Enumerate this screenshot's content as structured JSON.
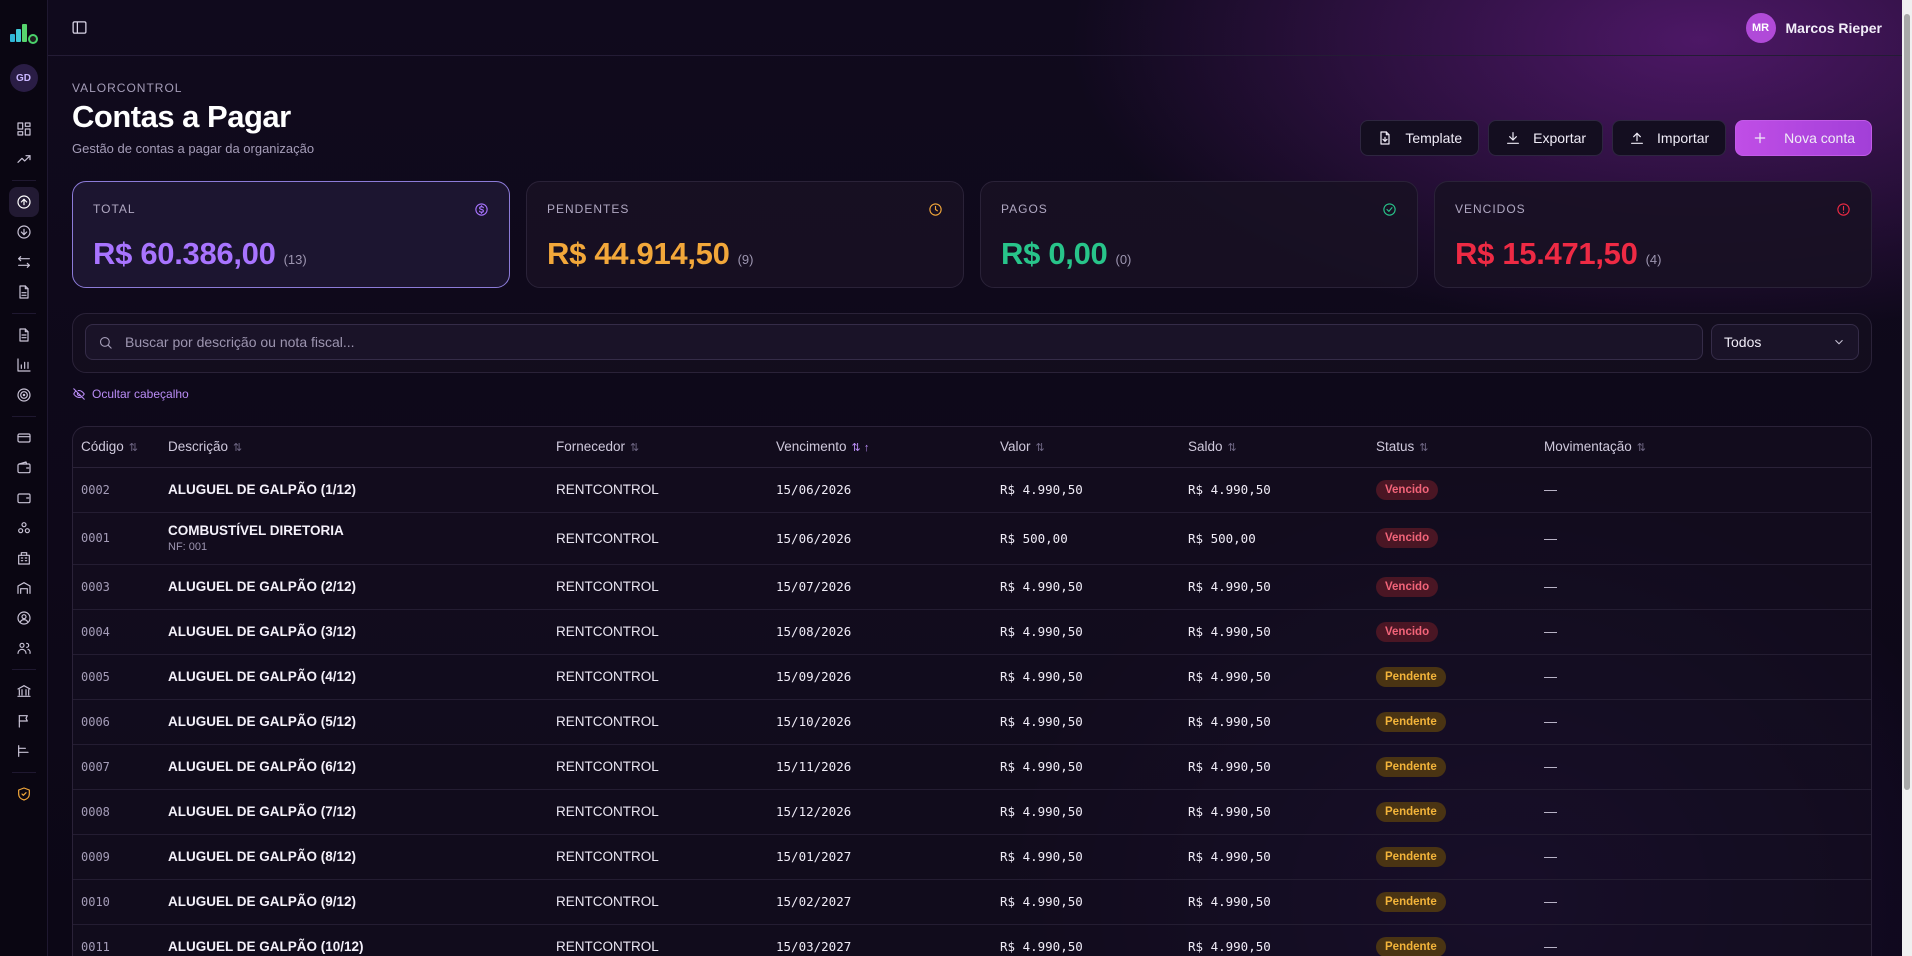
{
  "colors": {
    "total": "#a874ff",
    "pendentes": "#f2a73a",
    "pagos": "#28c48a",
    "vencidos": "#ee2a44",
    "accent": "#b04ad8"
  },
  "topbar": {
    "user_initials": "MR",
    "user_name": "Marcos Rieper"
  },
  "sidebar": {
    "workspace_initials": "GD"
  },
  "header": {
    "eyebrow": "VALORCONTROL",
    "title": "Contas a Pagar",
    "subtitle": "Gestão de contas a pagar da organização"
  },
  "actions": {
    "template": "Template",
    "export": "Exportar",
    "import": "Importar",
    "new": "Nova conta"
  },
  "cards": {
    "total": {
      "label": "TOTAL",
      "value": "R$ 60.386,00",
      "count": "(13)"
    },
    "pendentes": {
      "label": "PENDENTES",
      "value": "R$ 44.914,50",
      "count": "(9)"
    },
    "pagos": {
      "label": "PAGOS",
      "value": "R$ 0,00",
      "count": "(0)"
    },
    "vencidos": {
      "label": "VENCIDOS",
      "value": "R$ 15.471,50",
      "count": "(4)"
    }
  },
  "filters": {
    "search_placeholder": "Buscar por descrição ou nota fiscal...",
    "status_selected": "Todos",
    "hide_header": "Ocultar cabeçalho"
  },
  "table": {
    "columns": [
      "Código",
      "Descrição",
      "Fornecedor",
      "Vencimento",
      "Valor",
      "Saldo",
      "Status",
      "Movimentação"
    ],
    "rows": [
      {
        "code": "0002",
        "desc": "ALUGUEL DE GALPÃO (1/12)",
        "nf": "",
        "forn": "RENTCONTROL",
        "venc": "15/06/2026",
        "valor": "R$ 4.990,50",
        "saldo": "R$ 4.990,50",
        "status": "Vencido",
        "mov": "—"
      },
      {
        "code": "0001",
        "desc": "COMBUSTÍVEL DIRETORIA",
        "nf": "NF: 001",
        "forn": "RENTCONTROL",
        "venc": "15/06/2026",
        "valor": "R$ 500,00",
        "saldo": "R$ 500,00",
        "status": "Vencido",
        "mov": "—"
      },
      {
        "code": "0003",
        "desc": "ALUGUEL DE GALPÃO (2/12)",
        "nf": "",
        "forn": "RENTCONTROL",
        "venc": "15/07/2026",
        "valor": "R$ 4.990,50",
        "saldo": "R$ 4.990,50",
        "status": "Vencido",
        "mov": "—"
      },
      {
        "code": "0004",
        "desc": "ALUGUEL DE GALPÃO (3/12)",
        "nf": "",
        "forn": "RENTCONTROL",
        "venc": "15/08/2026",
        "valor": "R$ 4.990,50",
        "saldo": "R$ 4.990,50",
        "status": "Vencido",
        "mov": "—"
      },
      {
        "code": "0005",
        "desc": "ALUGUEL DE GALPÃO (4/12)",
        "nf": "",
        "forn": "RENTCONTROL",
        "venc": "15/09/2026",
        "valor": "R$ 4.990,50",
        "saldo": "R$ 4.990,50",
        "status": "Pendente",
        "mov": "—"
      },
      {
        "code": "0006",
        "desc": "ALUGUEL DE GALPÃO (5/12)",
        "nf": "",
        "forn": "RENTCONTROL",
        "venc": "15/10/2026",
        "valor": "R$ 4.990,50",
        "saldo": "R$ 4.990,50",
        "status": "Pendente",
        "mov": "—"
      },
      {
        "code": "0007",
        "desc": "ALUGUEL DE GALPÃO (6/12)",
        "nf": "",
        "forn": "RENTCONTROL",
        "venc": "15/11/2026",
        "valor": "R$ 4.990,50",
        "saldo": "R$ 4.990,50",
        "status": "Pendente",
        "mov": "—"
      },
      {
        "code": "0008",
        "desc": "ALUGUEL DE GALPÃO (7/12)",
        "nf": "",
        "forn": "RENTCONTROL",
        "venc": "15/12/2026",
        "valor": "R$ 4.990,50",
        "saldo": "R$ 4.990,50",
        "status": "Pendente",
        "mov": "—"
      },
      {
        "code": "0009",
        "desc": "ALUGUEL DE GALPÃO (8/12)",
        "nf": "",
        "forn": "RENTCONTROL",
        "venc": "15/01/2027",
        "valor": "R$ 4.990,50",
        "saldo": "R$ 4.990,50",
        "status": "Pendente",
        "mov": "—"
      },
      {
        "code": "0010",
        "desc": "ALUGUEL DE GALPÃO (9/12)",
        "nf": "",
        "forn": "RENTCONTROL",
        "venc": "15/02/2027",
        "valor": "R$ 4.990,50",
        "saldo": "R$ 4.990,50",
        "status": "Pendente",
        "mov": "—"
      },
      {
        "code": "0011",
        "desc": "ALUGUEL DE GALPÃO (10/12)",
        "nf": "",
        "forn": "RENTCONTROL",
        "venc": "15/03/2027",
        "valor": "R$ 4.990,50",
        "saldo": "R$ 4.990,50",
        "status": "Pendente",
        "mov": "—"
      }
    ]
  }
}
